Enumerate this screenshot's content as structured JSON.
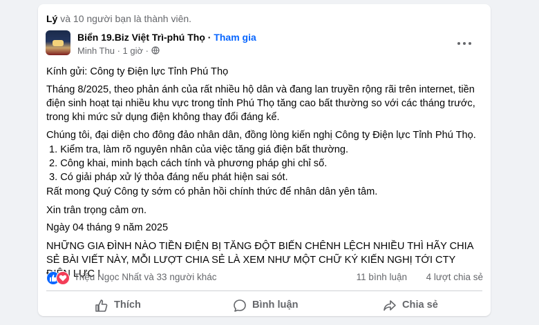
{
  "membership": {
    "name": "Lý",
    "rest": " và 10 người bạn là thành viên."
  },
  "post": {
    "group_name": "Biển 19.Biz Việt Trì-phú Thọ",
    "separator": " · ",
    "join_label": "Tham gia",
    "author": "Minh Thu",
    "time": " · 1 giờ · ",
    "greeting": "Kính gửi: Công ty Điện lực Tỉnh Phú Thọ",
    "paragraph1": "Tháng 8/2025, theo phản ánh của rất nhiều hộ dân và đang lan truyền rộng rãi trên internet, tiền điện sinh hoạt tại nhiều khu vực trong tỉnh Phú Thọ tăng cao bất thường so với các tháng trước, trong khi mức sử dụng điện không thay đổi đáng kể.",
    "paragraph2": "Chúng tôi, đại diện cho đông đảo nhân dân, đồng lòng kiến nghị Công ty Điện lực Tỉnh Phú Thọ.",
    "list": [
      "1. Kiểm tra, làm rõ nguyên nhân của việc tăng giá điện bất thường.",
      "2. Công khai, minh bạch cách tính và phương pháp ghi chỉ số.",
      "3. Có giải pháp xử lý thỏa đáng nếu phát hiện sai sót."
    ],
    "request": "Rất mong Quý Công ty sớm có phản hồi chính thức để nhân dân yên tâm.",
    "thanks": "Xin trân trọng cảm ơn.",
    "date": "Ngày 04 tháng 9 năm 2025",
    "caps": "NHỮNG GIA ĐÌNH NÀO TIỀN ĐIỆN BỊ TĂNG ĐỘT BIẾN CHÊNH LỆCH NHIỀU THÌ HÃY CHIA SẺ BÀI VIẾT NÀY, MỖI LƯỢT CHIA SẺ LÀ XEM NHƯ MỘT CHỮ KÝ KIẾN NGHỊ TỚI CTY ĐIỆN LỰC !"
  },
  "stats": {
    "reactions_text": "Triệu Ngọc Nhất và 33 người khác",
    "comments": "11 bình luận",
    "shares": "4 lượt chia sẻ"
  },
  "actions": {
    "like": "Thích",
    "comment": "Bình luận",
    "share": "Chia sẻ"
  },
  "icons": {
    "like_reaction": "like-reaction-icon",
    "love_reaction": "love-reaction-icon",
    "globe": "globe-icon",
    "more": "more-options-icon",
    "like": "thumbs-up-icon",
    "comment": "comment-bubble-icon",
    "share": "share-arrow-icon"
  },
  "colors": {
    "link_blue": "#0866ff",
    "secondary_text": "#65676b",
    "love_red": "#f33e58"
  }
}
